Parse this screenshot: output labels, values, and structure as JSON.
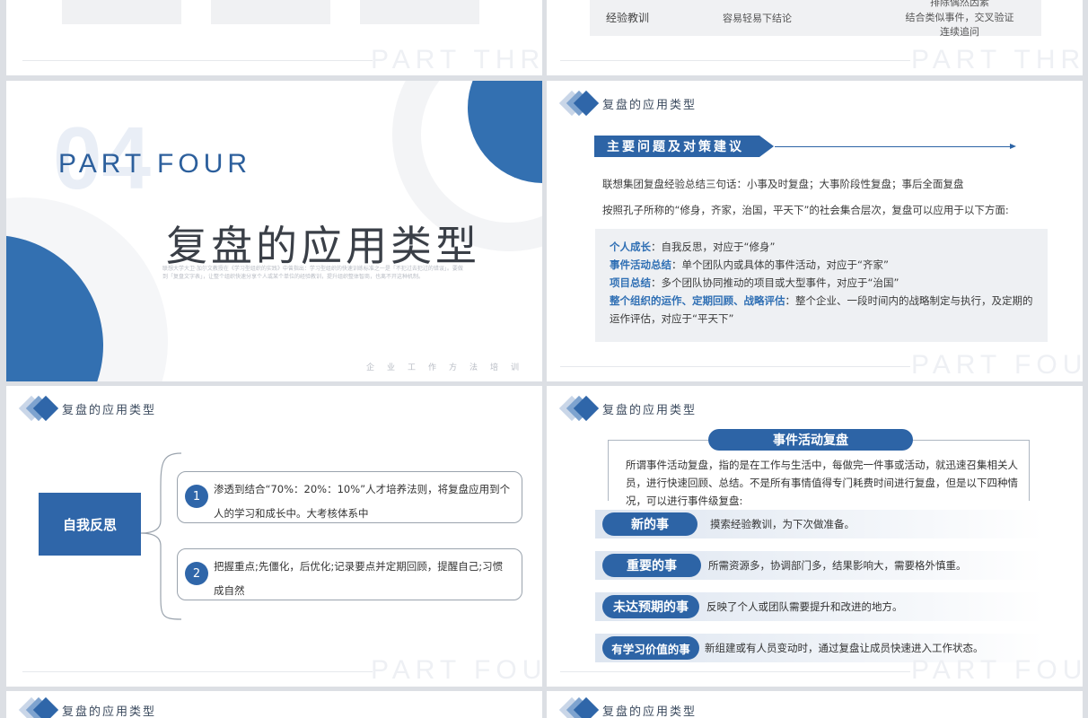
{
  "colors": {
    "primary_blue": "#2d64a6",
    "watermark": "#eef0f4",
    "background": "#dcdfe4"
  },
  "slide1": {
    "watermark": "PART THREE"
  },
  "slide2": {
    "watermark": "PART THREE",
    "row_label": "经验教训",
    "row_mid": "容易轻易下结论",
    "row_right_lines": [
      "排除偶然因素",
      "结合类似事件，交叉验证",
      "连续追问"
    ]
  },
  "slide3": {
    "big_number": "04",
    "part": "PART FOUR",
    "title": "复盘的应用类型",
    "tiny_text": "联想大学大卫·加尔文教授在《学习型组织的实践》中曾指出：学习型组织的快速训练标准之一是「不犯过去犯过的错误」。要做到「复盘文字表」，让整个组织快速分享个人或某个单位的经验教训，提升组织整体智商，也离不开这种机制。",
    "footer": "企业工作方法培训"
  },
  "slide4": {
    "header": "复盘的应用类型",
    "banner": "主要问题及对策建议",
    "line1": "联想集团复盘经验总结三句话：小事及时复盘；大事阶段性复盘；事后全面复盘",
    "line2": "按照孔子所称的“修身，齐家，治国，平天下”的社会集合层次，复盘可以应用于以下方面:",
    "items": [
      {
        "label": "个人成长",
        "text": "：自我反思，对应于“修身”"
      },
      {
        "label": "事件活动总结",
        "text": "：单个团队内或具体的事件活动，对应于“齐家”"
      },
      {
        "label": "项目总结",
        "text": "：多个团队协同推动的项目或大型事件，对应于“治国”"
      },
      {
        "label": "整个组织的运作、定期回顾、战略评估",
        "text": "：整个企业、一段时间内的战略制定与执行，及定期的运作评估，对应于“平天下”"
      }
    ],
    "watermark": "PART FOUR"
  },
  "slide5": {
    "header": "复盘的应用类型",
    "box_label": "自我反思",
    "points": [
      {
        "num": "1",
        "text": "渗透到结合“70%：20%：10%”人才培养法则，将复盘应用到个人的学习和成长中。大考核体系中"
      },
      {
        "num": "2",
        "text": "把握重点;先僵化，后优化;记录要点并定期回顾，提醒自己;习惯成自然"
      }
    ],
    "watermark": "PART FOUR"
  },
  "slide6": {
    "header": "复盘的应用类型",
    "title": "事件活动复盘",
    "para": "所谓事件活动复盘，指的是在工作与生活中，每做完一件事或活动，就迅速召集相关人员，进行快速回顾、总结。不是所有事情值得专门耗费时间进行复盘，但是以下四种情况，可以进行事件级复盘:",
    "rows": [
      {
        "label": "新的事",
        "text": "摸索经验教训，为下次做准备。"
      },
      {
        "label": "重要的事",
        "text": "所需资源多，协调部门多，结果影响大，需要格外慎重。"
      },
      {
        "label": "未达预期的事",
        "text": "反映了个人或团队需要提升和改进的地方。"
      },
      {
        "label": "有学习价值的事",
        "text": "新组建或有人员变动时，通过复盘让成员快速进入工作状态。"
      }
    ],
    "watermark": "PART FOUR"
  },
  "slide7": {
    "header": "复盘的应用类型"
  },
  "slide8": {
    "header": "复盘的应用类型"
  }
}
